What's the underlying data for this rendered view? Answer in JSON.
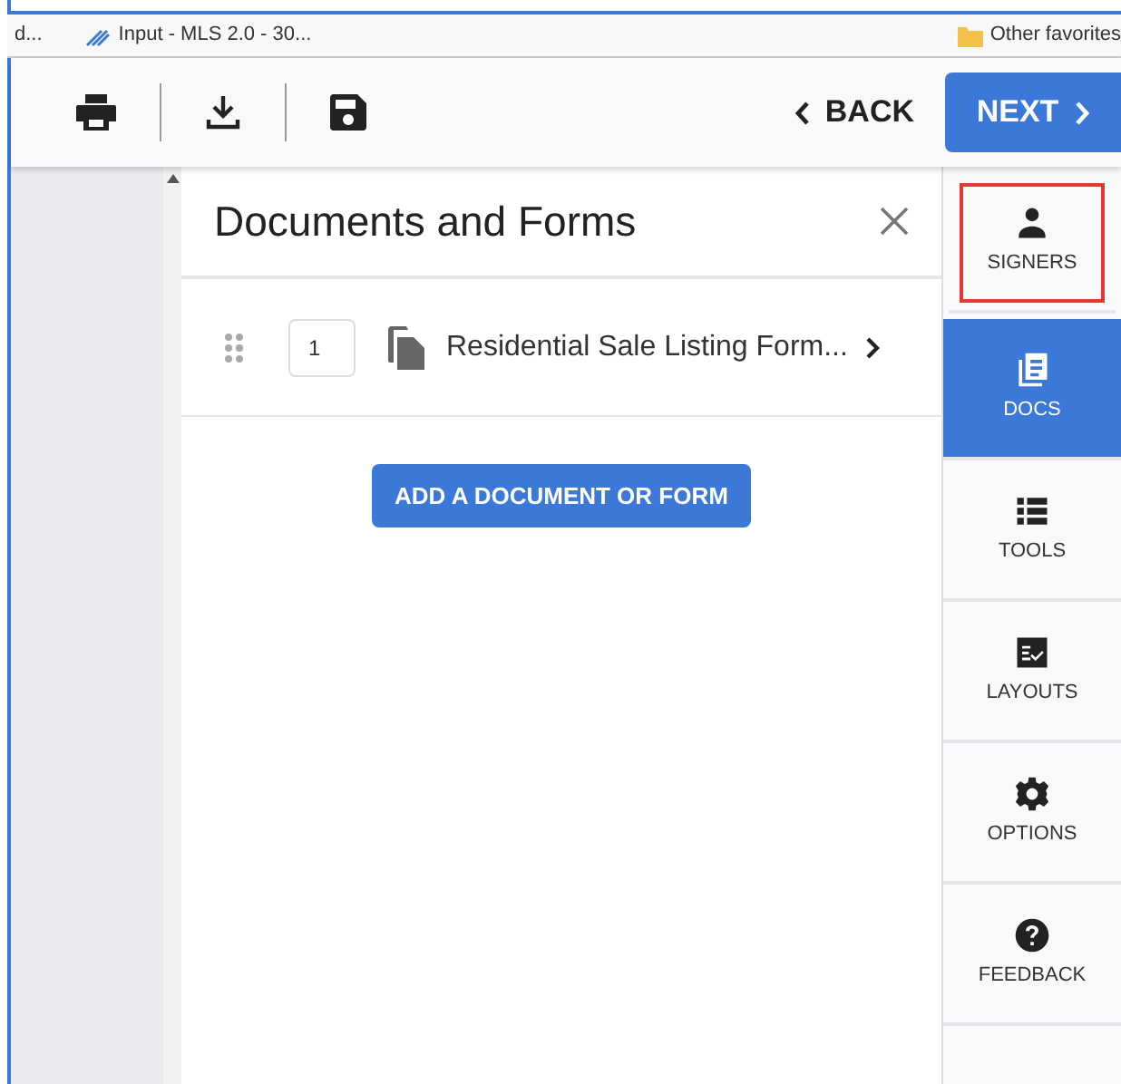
{
  "bookmarks_bar": {
    "items": [
      {
        "label": "d...",
        "kind": "text"
      },
      {
        "label": "Input - MLS 2.0 - 30...",
        "kind": "link"
      },
      {
        "label": "Other favorites",
        "kind": "folder"
      }
    ]
  },
  "toolbar": {
    "back_label": "BACK",
    "next_label": "NEXT"
  },
  "panel": {
    "title": "Documents and Forms",
    "documents": [
      {
        "order": "1",
        "title": "Residential Sale Listing Form..."
      }
    ],
    "add_button": "ADD A DOCUMENT OR FORM"
  },
  "sidebar": {
    "items": [
      {
        "label": "SIGNERS",
        "kind": "person",
        "selected": false,
        "highlighted": true
      },
      {
        "label": "DOCS",
        "kind": "docs",
        "selected": true,
        "highlighted": false
      },
      {
        "label": "TOOLS",
        "kind": "list",
        "selected": false,
        "highlighted": false
      },
      {
        "label": "LAYOUTS",
        "kind": "layout",
        "selected": false,
        "highlighted": false
      },
      {
        "label": "OPTIONS",
        "kind": "gear",
        "selected": false,
        "highlighted": false
      },
      {
        "label": "FEEDBACK",
        "kind": "help",
        "selected": false,
        "highlighted": false
      }
    ]
  }
}
